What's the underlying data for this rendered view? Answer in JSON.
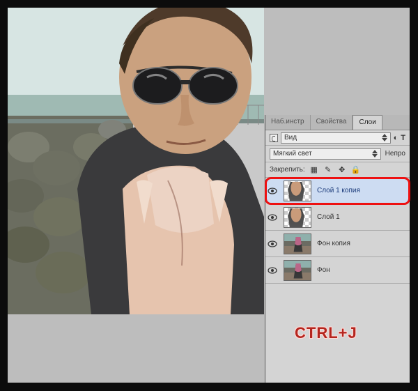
{
  "tabs": {
    "t1": "Наб.инстр",
    "t2": "Свойства",
    "t3": "Слои"
  },
  "filter": {
    "label": "Вид"
  },
  "type_glyphs": {
    "a": "◐",
    "b": "T"
  },
  "blend": {
    "mode": "Мягкий свет",
    "opacity_label": "Непро"
  },
  "lock": {
    "label": "Закрепить:"
  },
  "layers": {
    "l1": "Слой 1 копия",
    "l2": "Слой 1",
    "l3": "Фон копия",
    "l4": "Фон"
  },
  "shortcut": "CTRL+J"
}
